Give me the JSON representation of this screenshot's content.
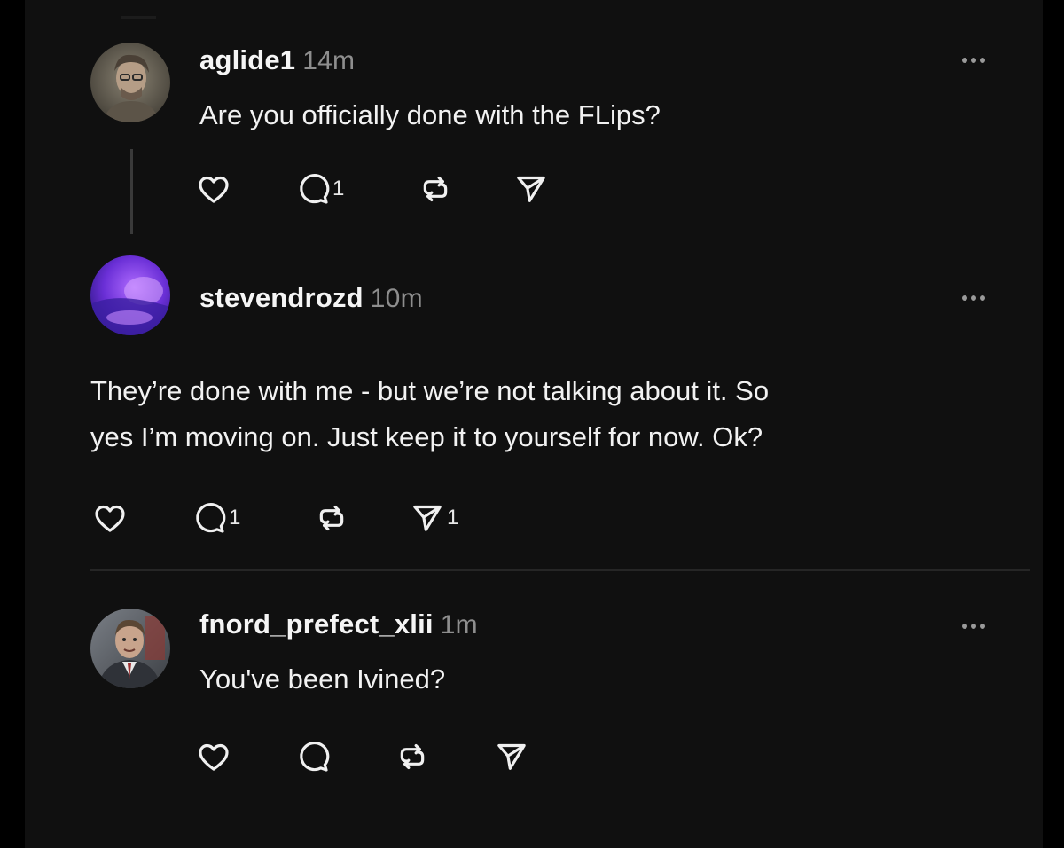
{
  "posts": [
    {
      "username": "aglide1",
      "time": "14m",
      "text": [
        "Are you officially done with the FLips?"
      ],
      "counts": {
        "likes": "",
        "replies": "1",
        "reposts": "",
        "shares": ""
      },
      "avatar": "avatar-man-with-glasses"
    },
    {
      "username": "stevendrozd",
      "time": "10m",
      "text": [
        "They’re done with me - but we’re not talking about it. So",
        "yes I’m moving on. Just keep it to yourself for now. Ok?"
      ],
      "counts": {
        "likes": "",
        "replies": "1",
        "reposts": "",
        "shares": "1"
      },
      "avatar": "avatar-purple-light"
    },
    {
      "username": "fnord_prefect_xlii",
      "time": "1m",
      "text": [
        "You've been Ivined?"
      ],
      "counts": {
        "likes": "",
        "replies": "",
        "reposts": "",
        "shares": ""
      },
      "avatar": "avatar-man-in-suit"
    }
  ],
  "icons": {
    "like": "heart-icon",
    "reply": "comment-icon",
    "repost": "repost-icon",
    "share": "send-icon",
    "more": "more-icon"
  },
  "colors": {
    "background": "#101010",
    "outer": "#000000",
    "text": "#f3f3f3",
    "muted": "#8e8e8e",
    "divider": "#262626"
  }
}
